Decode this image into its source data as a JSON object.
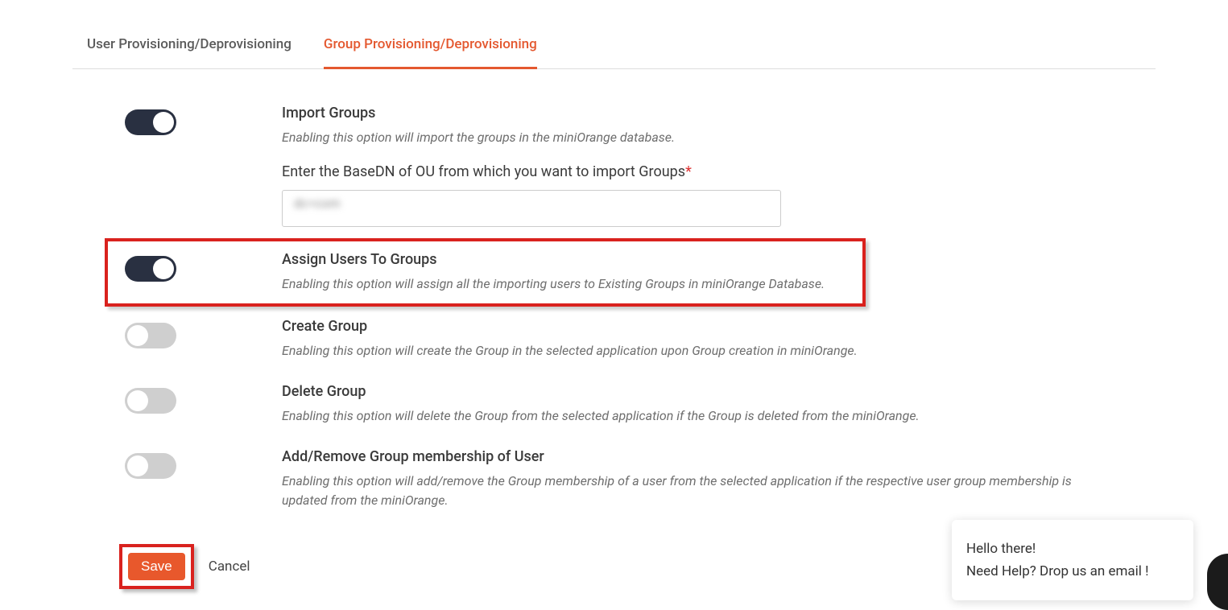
{
  "tabs": {
    "user": "User Provisioning/Deprovisioning",
    "group": "Group Provisioning/Deprovisioning"
  },
  "options": {
    "import_groups": {
      "title": "Import Groups",
      "desc": "Enabling this option will import the groups in the miniOrange database."
    },
    "basedn": {
      "label": "Enter the BaseDN of OU from which you want to import Groups",
      "value": "dc=com"
    },
    "assign_users": {
      "title": "Assign Users To Groups",
      "desc": "Enabling this option will assign all the importing users to Existing Groups in miniOrange Database."
    },
    "create_group": {
      "title": "Create Group",
      "desc": "Enabling this option will create the Group in the selected application upon Group creation in miniOrange."
    },
    "delete_group": {
      "title": "Delete Group",
      "desc": "Enabling this option will delete the Group from the selected application if the Group is deleted from the miniOrange."
    },
    "add_remove": {
      "title": "Add/Remove Group membership of User",
      "desc": "Enabling this option will add/remove the Group membership of a user from the selected application if the respective user group membership is updated from the miniOrange."
    }
  },
  "actions": {
    "save": "Save",
    "cancel": "Cancel"
  },
  "chat": {
    "line1": "Hello there!",
    "line2": "Need Help? Drop us an email !"
  }
}
